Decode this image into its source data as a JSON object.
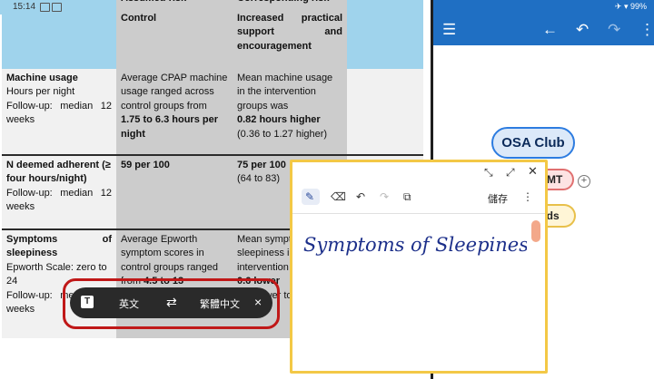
{
  "status_left": {
    "time": "15:14"
  },
  "status_right": {
    "battery": "99%"
  },
  "table": {
    "header_row": {
      "col2_partial": "Assumed risk",
      "col3_partial": "Corresponding risk",
      "col2": "Control",
      "col3": "Increased practical support and encouragement"
    },
    "rows": [
      {
        "outcome_title": "Machine usage",
        "outcome_sub": "Hours per night",
        "outcome_follow": "Follow-up: median 12 weeks",
        "control_text": "Average CPAP machine usage ranged across control groups from",
        "control_bold": "1.75 to 6.3 hours per night",
        "interv_text": "Mean machine usage in the intervention groups was",
        "interv_bold": "0.82 hours higher",
        "interv_ci": "(0.36 to 1.27 higher)"
      },
      {
        "outcome_title": "N deemed adherent (≥ four hours/night)",
        "outcome_follow": "Follow-up: median 12 weeks",
        "control_bold": "59 per 100",
        "interv_bold": "75 per 100",
        "interv_ci": "(64 to 83)"
      },
      {
        "outcome_title": "Symptoms of sleepiness",
        "outcome_sub": "Epworth Scale: zero to 24",
        "outcome_follow": "Follow-up: median 12 weeks",
        "control_text": "Average Epworth symptom scores in control groups ranged from",
        "control_bold": "4.5 to 13",
        "interv_text": "Mean symptom sleepiness in the intervention group was",
        "interv_bold": "0.6 lower",
        "interv_ci": "(1.8 lower to 0.6 higher)"
      }
    ]
  },
  "translate_bar": {
    "source_lang": "英文",
    "target_lang": "繁體中文",
    "swap": "⇄",
    "close": "×"
  },
  "mindmap": {
    "central": "OSA Club",
    "node_mt": "MT",
    "node_ads": "ads"
  },
  "note": {
    "save_label": "儲存",
    "handwriting": "Symptoms of Sleepiness"
  }
}
